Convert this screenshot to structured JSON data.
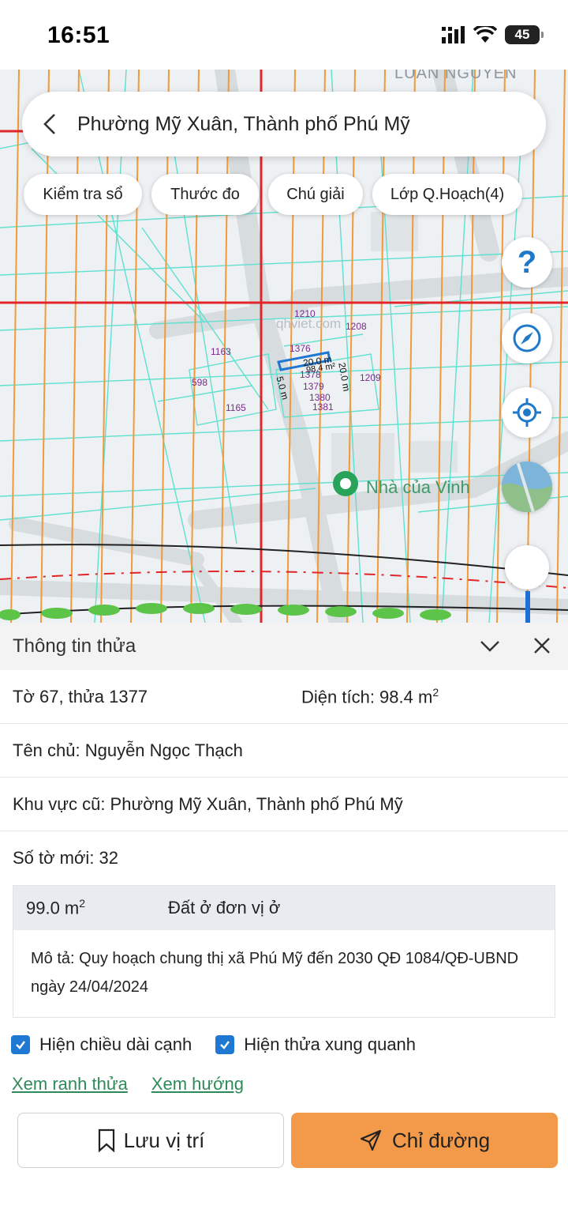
{
  "status": {
    "time": "16:51",
    "battery": "45"
  },
  "header": {
    "title": "Phường Mỹ Xuân, Thành phố Phú Mỹ"
  },
  "chips": [
    "Kiểm tra sổ",
    "Thước đo",
    "Chú giải",
    "Lớp Q.Hoạch(4)"
  ],
  "fab": {
    "help": "?"
  },
  "map": {
    "poi_label": "Nhà của Vinh",
    "area_label": "LUAN NGUYEN",
    "watermark": "qhviet.com",
    "parcels": [
      "1210",
      "1208",
      "1376",
      "1163",
      "1209",
      "598",
      "1378",
      "1379",
      "1380",
      "1381",
      "1165"
    ],
    "measurements": [
      "20.0 m",
      "20.0 m",
      "5.0 m",
      "98.4 m²"
    ]
  },
  "panel": {
    "title": "Thông tin thửa",
    "sheet_parcel": "Tờ 67, thửa 1377",
    "area_label": "Diện tích: 98.4 m",
    "area_sup": "2",
    "owner": "Tên chủ: Nguyễn Ngọc Thạch",
    "old_area": "Khu vực cũ: Phường Mỹ Xuân, Thành phố Phú Mỹ",
    "new_sheet": "Số tờ mới: 32",
    "plan": {
      "area": "99.0 m",
      "area_sup": "2",
      "land_type": "Đất ở đơn vị ở",
      "description": "Mô tả: Quy hoạch chung thị xã Phú Mỹ đến 2030 QĐ 1084/QĐ-UBND ngày 24/04/2024"
    },
    "checks": [
      {
        "label": "Hiện chiều dài cạnh",
        "checked": true
      },
      {
        "label": "Hiện thửa xung quanh",
        "checked": true
      }
    ],
    "links": [
      "Xem ranh thửa",
      "Xem hướng"
    ],
    "buttons": {
      "save": "Lưu vị trí",
      "route": "Chỉ đường"
    }
  },
  "colors": {
    "accent": "#f2994a",
    "link": "#2e8b57",
    "checkbox": "#1f78d1",
    "grid_red": "#e0262b",
    "grid_orange": "#f29a3a",
    "parcel_lines": "#5fe0d0"
  }
}
